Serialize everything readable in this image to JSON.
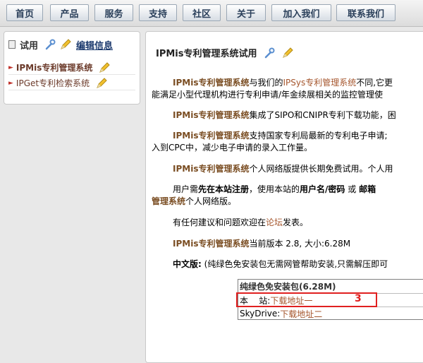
{
  "nav": [
    {
      "label": "首页"
    },
    {
      "label": "产品"
    },
    {
      "label": "服务"
    },
    {
      "label": "支持"
    },
    {
      "label": "社区"
    },
    {
      "label": "关于"
    },
    {
      "label": "加入我们"
    },
    {
      "label": "联系我们"
    }
  ],
  "sidebar": {
    "title": "试用",
    "edit": "编辑信息",
    "items": [
      {
        "label": "IPMis专利管理系统"
      },
      {
        "label": "IPGet专利检索系统"
      }
    ]
  },
  "main": {
    "title": "IPMis专利管理系统试用",
    "p1": {
      "brand": "IPMis专利管理系统",
      "t1": "与我们的",
      "link": "IPSys专利管理系统",
      "t2": "不同,它更",
      "line2": "能满足小型代理机构进行专利申请/年金续展相关的监控管理使"
    },
    "p2": {
      "brand": "IPMis专利管理系统",
      "text": "集成了SIPO和CNIPR专利下载功能，困"
    },
    "p3": {
      "brand": "IPMis专利管理系统",
      "text": "支持国家专利局最新的专利电子申请;",
      "line2": "入到CPC中，减少电子申请的录入工作量。"
    },
    "p4": {
      "brand": "IPMis专利管理系统",
      "text": "个人网络版提供长期免费试用。个人用"
    },
    "p5": {
      "t1": "用户需",
      "b1": "先在本站注册",
      "t2": "，使用本站的",
      "b2": "用户名/密码",
      "t3": " 或 ",
      "b3": "邮箱",
      "line2_brand": "管理系统",
      "line2_text": "个人网络版。"
    },
    "p6": {
      "t1": "有任何建议和问题欢迎在",
      "link": "论坛",
      "t2": "发表。"
    },
    "p7": {
      "brand": "IPMis专利管理系统",
      "text": "当前版本 2.8, 大小:6.28M"
    },
    "p8": {
      "label": "中文版:",
      "text": "(纯绿色免安装包无需网管帮助安装,只需解压即可"
    }
  },
  "download": {
    "header": "纯绿色免安装包(6.28M)",
    "rows": [
      {
        "label": "本    站:",
        "link": "下载地址一"
      },
      {
        "label": "SkyDrive:",
        "link": "下载地址二"
      }
    ],
    "annotation": "3"
  },
  "colors": {
    "accent": "#e02020",
    "brand": "#7a4d22",
    "link": "#a5552c"
  }
}
